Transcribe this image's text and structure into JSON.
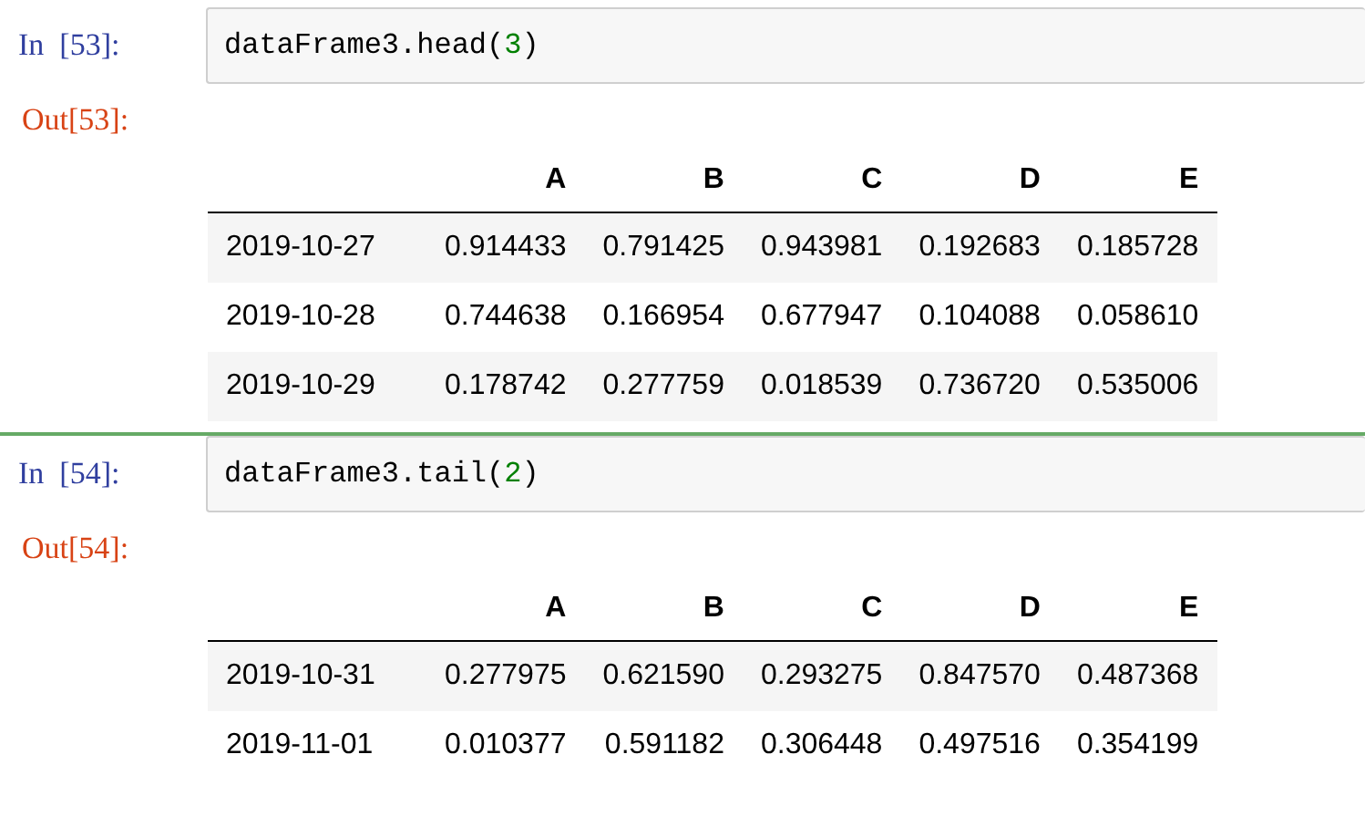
{
  "cells": [
    {
      "selected": false,
      "prompt_in": "In  [53]:",
      "code": [
        {
          "kind": "plain",
          "text": "dataFrame3.head("
        },
        {
          "kind": "number",
          "text": "3"
        },
        {
          "kind": "plain",
          "text": ")"
        }
      ],
      "prompt_out": "Out[53]:",
      "table": {
        "columns": [
          "",
          "A",
          "B",
          "C",
          "D",
          "E"
        ],
        "rows": [
          [
            "2019-10-27",
            "0.914433",
            "0.791425",
            "0.943981",
            "0.192683",
            "0.185728"
          ],
          [
            "2019-10-28",
            "0.744638",
            "0.166954",
            "0.677947",
            "0.104088",
            "0.058610"
          ],
          [
            "2019-10-29",
            "0.178742",
            "0.277759",
            "0.018539",
            "0.736720",
            "0.535006"
          ]
        ]
      }
    },
    {
      "selected": true,
      "prompt_in": "In  [54]:",
      "code": [
        {
          "kind": "plain",
          "text": "dataFrame3.tail("
        },
        {
          "kind": "number",
          "text": "2"
        },
        {
          "kind": "plain",
          "text": ")"
        }
      ],
      "prompt_out": "Out[54]:",
      "table": {
        "columns": [
          "",
          "A",
          "B",
          "C",
          "D",
          "E"
        ],
        "rows": [
          [
            "2019-10-31",
            "0.277975",
            "0.621590",
            "0.293275",
            "0.847570",
            "0.487368"
          ],
          [
            "2019-11-01",
            "0.010377",
            "0.591182",
            "0.306448",
            "0.497516",
            "0.354199"
          ]
        ]
      }
    }
  ]
}
